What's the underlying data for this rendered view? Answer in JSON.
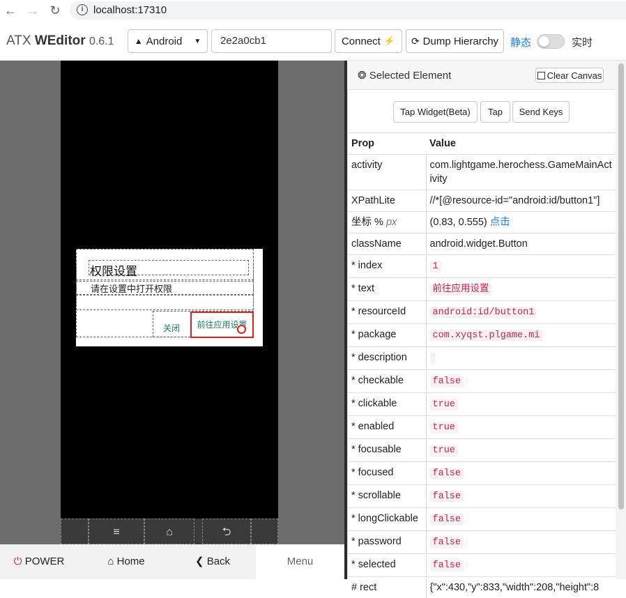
{
  "browser": {
    "url": "localhost:17310"
  },
  "app": {
    "brand": "ATX",
    "brand_bold": "WEditor",
    "version": "0.6.1"
  },
  "toolbar": {
    "platform": "Android",
    "serial": "2e2a0cb1",
    "connect_label": "Connect",
    "dump_label": "Dump Hierarchy",
    "static_label": "静态",
    "realtime_label": "实时",
    "realtime_on": false
  },
  "device": {
    "dialog_title": "权限设置",
    "dialog_message": "请在设置中打开权限",
    "close_label": "关闭",
    "goto_label": "前往应用设置",
    "softkeys": [
      "≡",
      "⌂",
      "⮌"
    ]
  },
  "bottom": {
    "power": "POWER",
    "home": "Home",
    "back": "Back",
    "menu": "Menu"
  },
  "panel": {
    "title": "Selected Element",
    "clear_label": "Clear Canvas",
    "tap_widget_label": "Tap Widget(Beta)",
    "tap_label": "Tap",
    "send_keys_label": "Send Keys",
    "col_prop": "Prop",
    "col_value": "Value"
  },
  "props": {
    "activity": {
      "k": "activity",
      "v": "com.lightgame.herochess.GameMainActivity"
    },
    "xpath": {
      "k": "XPathLite",
      "v": "//*[@resource-id=\"android:id/button1\"]"
    },
    "coord": {
      "k": "坐标 %",
      "k2": "px",
      "v": "(0.83, 0.555)",
      "link": "点击"
    },
    "classname": {
      "k": "className",
      "v": "android.widget.Button"
    },
    "index": {
      "k": "* index",
      "v": "1"
    },
    "text": {
      "k": "* text",
      "v": "前往应用设置"
    },
    "resourceid": {
      "k": "* resourceId",
      "v": "android:id/button1"
    },
    "package": {
      "k": "* package",
      "v": "com.xyqst.plgame.mi"
    },
    "description": {
      "k": "* description",
      "v": ""
    },
    "checkable": {
      "k": "* checkable",
      "v": "false"
    },
    "clickable": {
      "k": "* clickable",
      "v": "true"
    },
    "enabled": {
      "k": "* enabled",
      "v": "true"
    },
    "focusable": {
      "k": "* focusable",
      "v": "true"
    },
    "focused": {
      "k": "* focused",
      "v": "false"
    },
    "scrollable": {
      "k": "* scrollable",
      "v": "false"
    },
    "longclickable": {
      "k": "* longClickable",
      "v": "false"
    },
    "password": {
      "k": "* password",
      "v": "false"
    },
    "selected": {
      "k": "* selected",
      "v": "false"
    },
    "rect": {
      "k": "# rect",
      "v": "{\"x\":430,\"y\":833,\"width\":208,\"height\":8"
    }
  }
}
